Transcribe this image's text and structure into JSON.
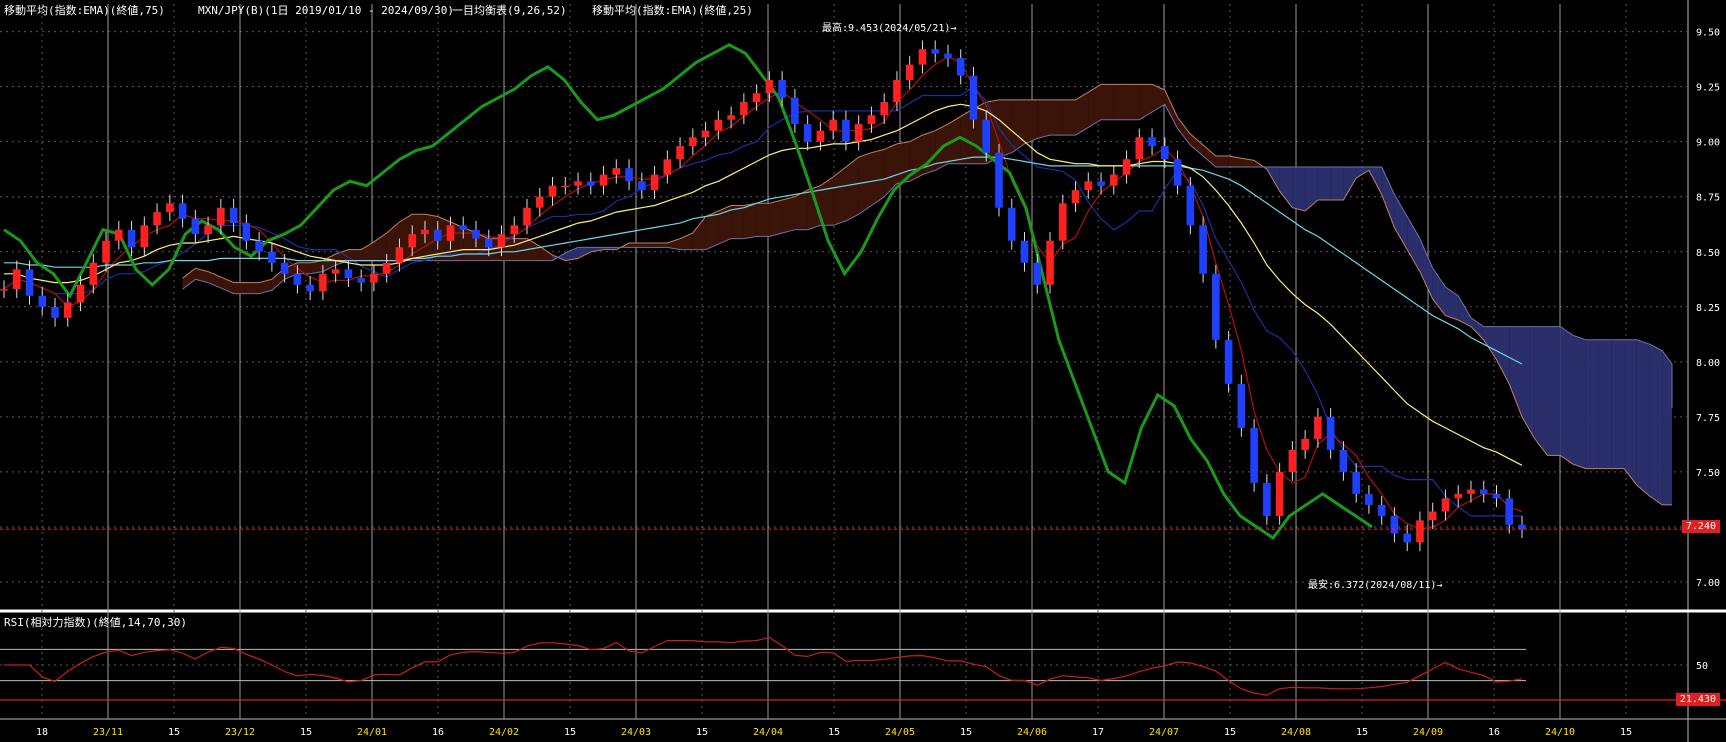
{
  "header": {
    "ema75": "移動平均(指数:EMA)(終値,75)",
    "symbol": "MXN/JPY(B)(1日 2019/01/10 - 2024/09/30)",
    "ichimoku": "一目均衡表(9,26,52)",
    "ema25": "移動平均(指数:EMA)(終値,25)"
  },
  "rsi_title": "RSI(相対力指数)(終値,14,70,30)",
  "annotations": {
    "high": "最高:9.453(2024/05/21)→",
    "low": "最安:6.372(2024/08/11)→"
  },
  "price_tag": "7.240",
  "rsi_tag": "21.430",
  "colors": {
    "bg": "#000000",
    "up": "#ff2020",
    "down": "#2040ff",
    "chikou": "#1a9a1a",
    "ema25": "#ffef7a",
    "ema75": "#6fd6e6",
    "tenkan": "#b01010",
    "kijun": "#1a2fa0",
    "cloud_bull": "#3a1408",
    "cloud_bear": "#2a2e6a",
    "rsi": "#c81e1e",
    "grid": "#5a5a5a"
  },
  "chart_data": {
    "type": "candlestick",
    "price_axis": {
      "range": [
        6.9,
        9.58
      ],
      "ticks": [
        "9.50",
        "9.25",
        "9.00",
        "8.75",
        "8.50",
        "8.25",
        "8.00",
        "7.75",
        "7.50",
        "7.25",
        "7.00"
      ]
    },
    "rsi_axis": {
      "range": [
        0,
        100
      ],
      "ticks": [
        "50"
      ]
    },
    "x_axis": {
      "labels": [
        "18",
        "23/11",
        "15",
        "23/12",
        "15",
        "24/01",
        "16",
        "24/02",
        "15",
        "24/03",
        "15",
        "24/04",
        "15",
        "24/05",
        "15",
        "24/06",
        "17",
        "24/07",
        "15",
        "24/08",
        "15",
        "24/09",
        "16",
        "24/10",
        "15"
      ]
    },
    "current_price": 7.24,
    "rsi_current": 21.43,
    "high": {
      "value": 9.453,
      "date": "2024/05/21"
    },
    "low": {
      "value": 6.372,
      "date": "2024/08/11"
    },
    "close_series": [
      8.33,
      8.42,
      8.3,
      8.25,
      8.2,
      8.27,
      8.35,
      8.45,
      8.55,
      8.6,
      8.52,
      8.62,
      8.68,
      8.72,
      8.65,
      8.58,
      8.62,
      8.7,
      8.63,
      8.55,
      8.5,
      8.45,
      8.4,
      8.35,
      8.32,
      8.4,
      8.42,
      8.38,
      8.36,
      8.4,
      8.45,
      8.52,
      8.58,
      8.6,
      8.55,
      8.62,
      8.6,
      8.56,
      8.52,
      8.58,
      8.62,
      8.7,
      8.75,
      8.8,
      8.8,
      8.82,
      8.8,
      8.85,
      8.88,
      8.82,
      8.78,
      8.85,
      8.92,
      8.98,
      9.02,
      9.05,
      9.1,
      9.12,
      9.18,
      9.22,
      9.28,
      9.2,
      9.08,
      9.0,
      9.05,
      9.1,
      9.0,
      9.08,
      9.12,
      9.18,
      9.28,
      9.35,
      9.42,
      9.4,
      9.38,
      9.3,
      9.1,
      8.95,
      8.7,
      8.55,
      8.45,
      8.35,
      8.55,
      8.72,
      8.78,
      8.82,
      8.8,
      8.85,
      8.92,
      9.02,
      8.98,
      8.92,
      8.8,
      8.62,
      8.4,
      8.1,
      7.9,
      7.7,
      7.45,
      7.3,
      7.5,
      7.6,
      7.65,
      7.75,
      7.6,
      7.5,
      7.4,
      7.35,
      7.3,
      7.22,
      7.18,
      7.28,
      7.32,
      7.38,
      7.4,
      7.42,
      7.4,
      7.38,
      7.26,
      7.24
    ],
    "ema25_series": [
      8.4,
      8.4,
      8.38,
      8.37,
      8.36,
      8.36,
      8.37,
      8.39,
      8.42,
      8.45,
      8.46,
      8.48,
      8.51,
      8.53,
      8.54,
      8.54,
      8.55,
      8.56,
      8.57,
      8.56,
      8.55,
      8.54,
      8.52,
      8.5,
      8.48,
      8.47,
      8.46,
      8.45,
      8.44,
      8.44,
      8.44,
      8.45,
      8.47,
      8.48,
      8.49,
      8.5,
      8.51,
      8.51,
      8.51,
      8.52,
      8.53,
      8.55,
      8.57,
      8.59,
      8.61,
      8.63,
      8.64,
      8.66,
      8.68,
      8.69,
      8.7,
      8.71,
      8.73,
      8.75,
      8.77,
      8.8,
      8.82,
      8.85,
      8.88,
      8.91,
      8.94,
      8.96,
      8.97,
      8.97,
      8.98,
      8.99,
      8.99,
      9.0,
      9.01,
      9.03,
      9.05,
      9.08,
      9.11,
      9.14,
      9.16,
      9.17,
      9.16,
      9.14,
      9.1,
      9.05,
      9.0,
      8.95,
      8.92,
      8.91,
      8.9,
      8.9,
      8.89,
      8.89,
      8.89,
      8.9,
      8.91,
      8.91,
      8.9,
      8.88,
      8.84,
      8.78,
      8.71,
      8.63,
      8.54,
      8.44,
      8.37,
      8.31,
      8.26,
      8.22,
      8.17,
      8.11,
      8.05,
      7.99,
      7.93,
      7.87,
      7.81,
      7.77,
      7.73,
      7.7,
      7.67,
      7.64,
      7.61,
      7.59,
      7.56,
      7.53
    ],
    "ema75_series": [
      8.45,
      8.45,
      8.44,
      8.44,
      8.43,
      8.43,
      8.43,
      8.43,
      8.44,
      8.44,
      8.44,
      8.45,
      8.45,
      8.46,
      8.46,
      8.46,
      8.46,
      8.47,
      8.47,
      8.47,
      8.47,
      8.47,
      8.47,
      8.46,
      8.46,
      8.46,
      8.46,
      8.46,
      8.46,
      8.46,
      8.46,
      8.46,
      8.47,
      8.47,
      8.48,
      8.48,
      8.49,
      8.49,
      8.49,
      8.5,
      8.5,
      8.51,
      8.52,
      8.53,
      8.54,
      8.55,
      8.56,
      8.57,
      8.58,
      8.59,
      8.6,
      8.61,
      8.62,
      8.63,
      8.65,
      8.66,
      8.67,
      8.69,
      8.7,
      8.72,
      8.74,
      8.75,
      8.76,
      8.77,
      8.78,
      8.79,
      8.8,
      8.81,
      8.82,
      8.83,
      8.85,
      8.87,
      8.88,
      8.9,
      8.91,
      8.92,
      8.93,
      8.93,
      8.93,
      8.92,
      8.91,
      8.9,
      8.89,
      8.89,
      8.89,
      8.89,
      8.89,
      8.89,
      8.89,
      8.89,
      8.89,
      8.89,
      8.89,
      8.88,
      8.87,
      8.85,
      8.83,
      8.8,
      8.76,
      8.72,
      8.68,
      8.64,
      8.6,
      8.57,
      8.53,
      8.49,
      8.45,
      8.41,
      8.37,
      8.33,
      8.29,
      8.25,
      8.21,
      8.18,
      8.15,
      8.11,
      8.08,
      8.05,
      8.02,
      7.99
    ],
    "chikou_series": [
      8.6,
      8.55,
      8.45,
      8.4,
      8.3,
      8.45,
      8.6,
      8.58,
      8.42,
      8.35,
      8.42,
      8.58,
      8.64,
      8.6,
      8.52,
      8.48,
      8.55,
      8.58,
      8.62,
      8.7,
      8.78,
      8.82,
      8.8,
      8.86,
      8.92,
      8.96,
      8.98,
      9.04,
      9.1,
      9.16,
      9.2,
      9.24,
      9.3,
      9.34,
      9.28,
      9.18,
      9.1,
      9.12,
      9.16,
      9.2,
      9.24,
      9.3,
      9.36,
      9.4,
      9.44,
      9.4,
      9.3,
      9.2,
      9.0,
      8.78,
      8.55,
      8.4,
      8.5,
      8.65,
      8.78,
      8.85,
      8.9,
      8.98,
      9.02,
      8.98,
      8.92,
      8.86,
      8.7,
      8.4,
      8.1,
      7.9,
      7.7,
      7.5,
      7.45,
      7.7,
      7.85,
      7.8,
      7.65,
      7.55,
      7.4,
      7.3,
      7.25,
      7.2,
      7.3,
      7.35,
      7.4,
      7.35,
      7.3,
      7.25
    ]
  }
}
